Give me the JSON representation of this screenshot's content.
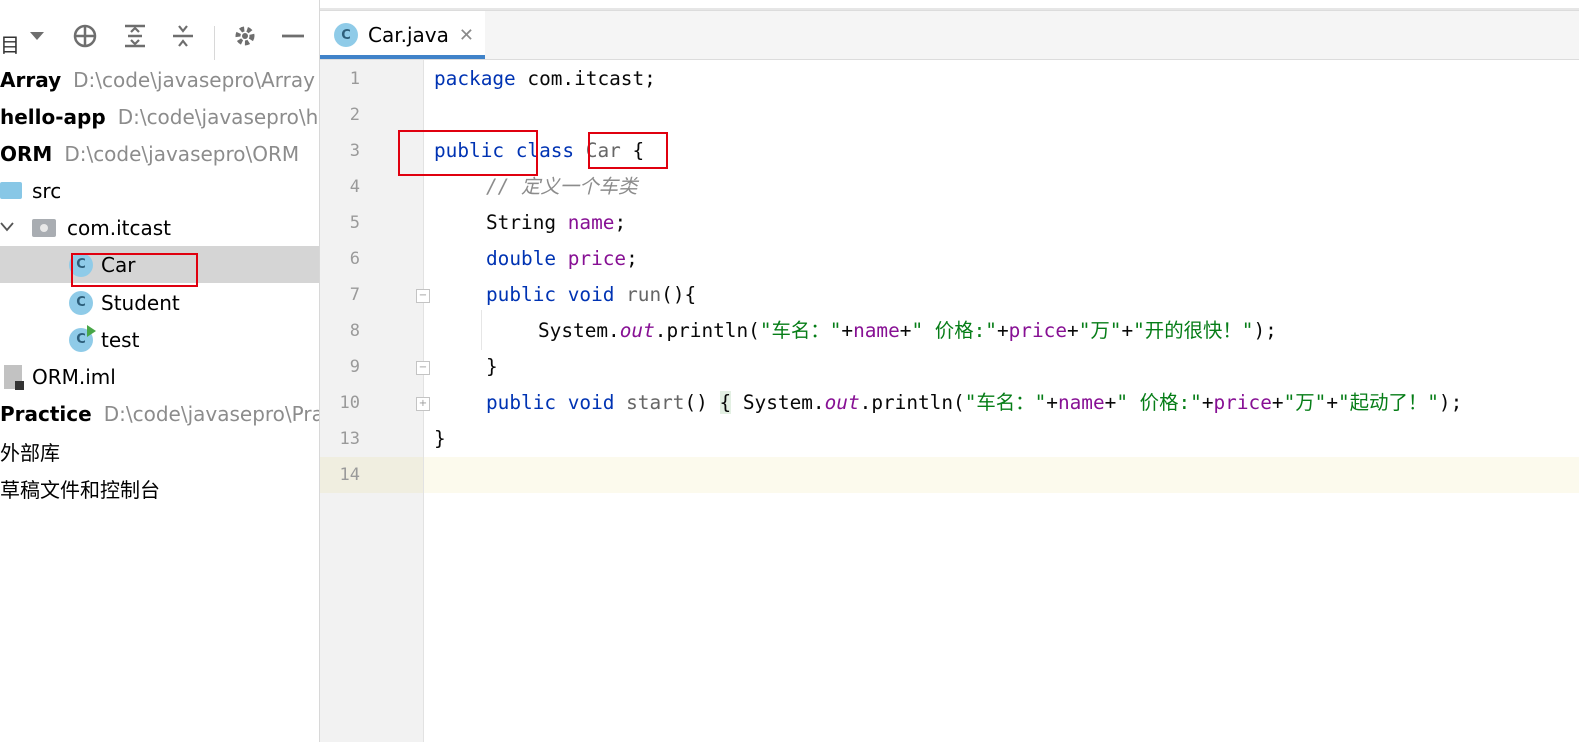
{
  "left_panel": {
    "toolbar": {
      "partial_label": "目",
      "icons": [
        "dropdown-arrow-icon",
        "locate-icon",
        "expand-all-icon",
        "collapse-all-icon",
        "gear-icon",
        "minimize-icon"
      ]
    },
    "tree": [
      {
        "name": "Array",
        "path": "D:\\code\\javasepro\\Array",
        "kind": "project"
      },
      {
        "name": "hello-app",
        "path": "D:\\code\\javasepro\\hello-app",
        "kind": "project"
      },
      {
        "name": "ORM",
        "path": "D:\\code\\javasepro\\ORM",
        "kind": "project"
      },
      {
        "name": "src",
        "kind": "folder"
      },
      {
        "name": "com.itcast",
        "kind": "package"
      },
      {
        "name": "Car",
        "kind": "class",
        "selected": true
      },
      {
        "name": "Student",
        "kind": "class"
      },
      {
        "name": "test",
        "kind": "runnable-class"
      },
      {
        "name": "ORM.iml",
        "kind": "iml"
      },
      {
        "name": "Practice",
        "path": "D:\\code\\javasepro\\Practice",
        "kind": "project"
      },
      {
        "name": "外部库",
        "kind": "node"
      },
      {
        "name": "草稿文件和控制台",
        "kind": "node"
      }
    ]
  },
  "editor": {
    "tab": {
      "label": "Car.java",
      "icon_letter": "C"
    },
    "line_numbers": [
      "1",
      "2",
      "3",
      "4",
      "5",
      "6",
      "7",
      "8",
      "9",
      "10",
      "13",
      "14"
    ],
    "code": {
      "l1_kw": "package",
      "l1_rest": " com.itcast;",
      "l3_kw1": "public",
      "l3_kw2": "class",
      "l3_name": "Car",
      "l3_brace": " {",
      "l4": "// 定义一个车类",
      "l5_type": "String",
      "l5_field": "name",
      "l5_end": ";",
      "l6_type": "double",
      "l6_field": "price",
      "l6_end": ";",
      "l7_kw": "public void",
      "l7_name": "run",
      "l7_end": "(){",
      "l8_a": "System.",
      "l8_out": "out",
      "l8_b": ".println(",
      "l8_s1": "\"车名：\"",
      "l8_p1": "+",
      "l8_f1": "name",
      "l8_p2": "+",
      "l8_s2": "\" 价格:\"",
      "l8_p3": "+",
      "l8_f2": "price",
      "l8_p4": "+",
      "l8_s3": "\"万\"",
      "l8_p5": "+",
      "l8_s4": "\"开的很快！\"",
      "l8_end": ");",
      "l9": "}",
      "l10_kw": "public void",
      "l10_name": "start",
      "l10_paren": "() ",
      "l10_brace": "{",
      "l10_a": " System.",
      "l10_out": "out",
      "l10_b": ".println(",
      "l10_s1": "\"车名：\"",
      "l10_p1": "+",
      "l10_f1": "name",
      "l10_p2": "+",
      "l10_s2": "\" 价格:\"",
      "l10_p3": "+",
      "l10_f2": "price",
      "l10_p4": "+",
      "l10_s3": "\"万\"",
      "l10_p5": "+",
      "l10_s4": "\"起动了！\"",
      "l10_end": ");",
      "l13": "}"
    }
  },
  "colors": {
    "keyword": "#0033b3",
    "field": "#871094",
    "string": "#067d17",
    "comment": "#8c8c8c",
    "annotation": "#e0000f",
    "class_icon": "#8fcbe8"
  }
}
